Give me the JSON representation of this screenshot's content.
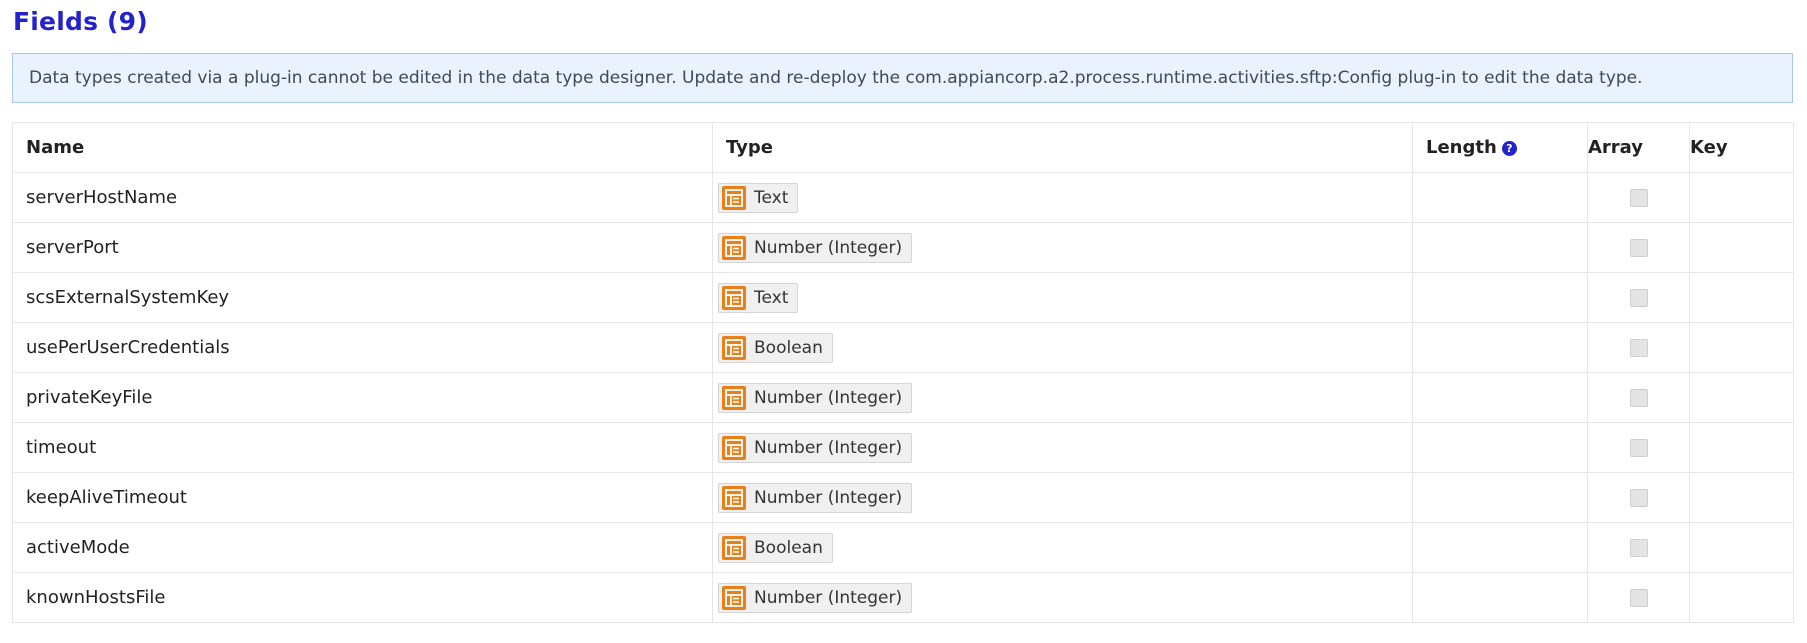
{
  "heading": "Fields (9)",
  "info_message": "Data types created via a plug-in cannot be edited in the data type designer. Update and re-deploy the com.appiancorp.a2.process.runtime.activities.sftp:Config plug-in to edit the data type.",
  "table": {
    "columns": {
      "name": "Name",
      "type": "Type",
      "length": "Length",
      "array": "Array",
      "key": "Key"
    },
    "rows": [
      {
        "name": "serverHostName",
        "type": "Text",
        "length": "",
        "array": false
      },
      {
        "name": "serverPort",
        "type": "Number (Integer)",
        "length": "",
        "array": false
      },
      {
        "name": "scsExternalSystemKey",
        "type": "Text",
        "length": "",
        "array": false
      },
      {
        "name": "usePerUserCredentials",
        "type": "Boolean",
        "length": "",
        "array": false
      },
      {
        "name": "privateKeyFile",
        "type": "Number (Integer)",
        "length": "",
        "array": false
      },
      {
        "name": "timeout",
        "type": "Number (Integer)",
        "length": "",
        "array": false
      },
      {
        "name": "keepAliveTimeout",
        "type": "Number (Integer)",
        "length": "",
        "array": false
      },
      {
        "name": "activeMode",
        "type": "Boolean",
        "length": "",
        "array": false
      },
      {
        "name": "knownHostsFile",
        "type": "Number (Integer)",
        "length": "",
        "array": false
      }
    ]
  },
  "icons": {
    "help": "help-icon",
    "type": "data-type-icon"
  },
  "colors": {
    "heading": "#2322d0",
    "info_background": "#e9f2fd",
    "type_icon": "#e8801a"
  }
}
